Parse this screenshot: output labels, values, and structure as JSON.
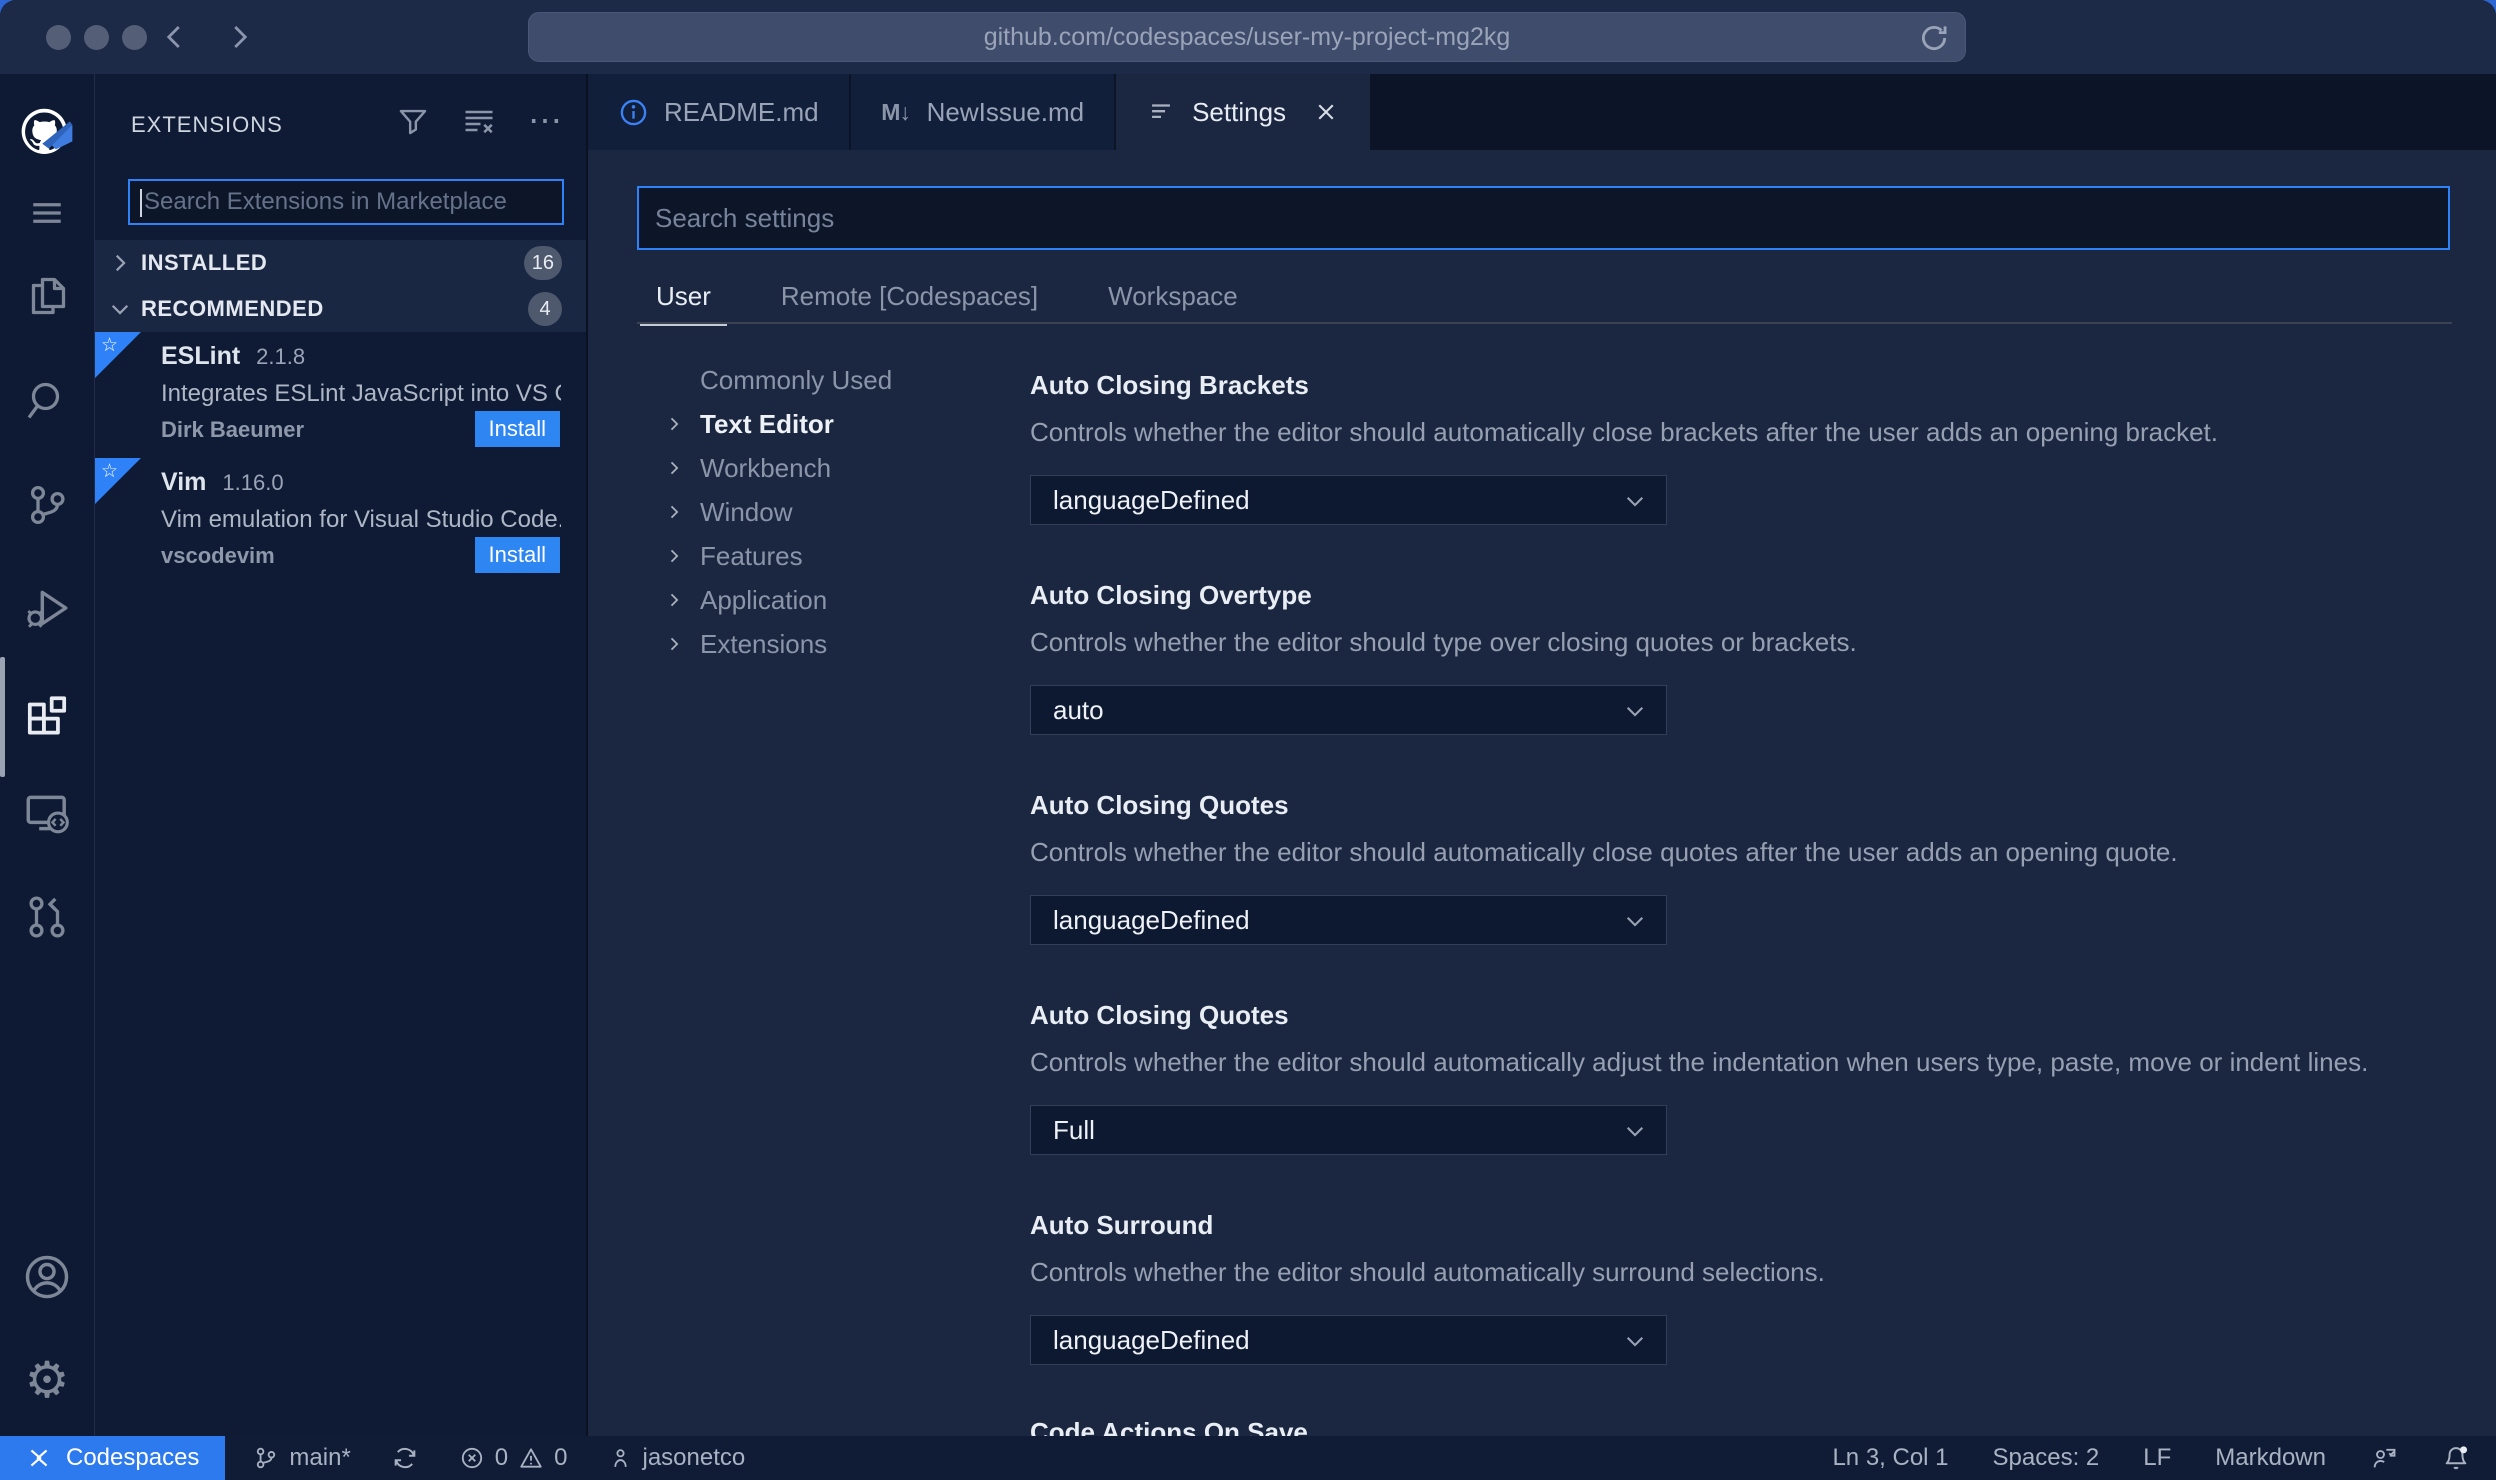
{
  "browser": {
    "url": "github.com/codespaces/user-my-project-mg2kg"
  },
  "sidebar": {
    "title": "EXTENSIONS",
    "search_placeholder": "Search Extensions in Marketplace",
    "sections": [
      {
        "label": "INSTALLED",
        "count": "16"
      },
      {
        "label": "RECOMMENDED",
        "count": "4"
      }
    ],
    "extensions": [
      {
        "name": "ESLint",
        "version": "2.1.8",
        "description": "Integrates ESLint JavaScript into VS C...",
        "author": "Dirk Baeumer",
        "action_label": "Install"
      },
      {
        "name": "Vim",
        "version": "1.16.0",
        "description": "Vim emulation for Visual Studio Code...",
        "author": "vscodevim",
        "action_label": "Install"
      }
    ]
  },
  "editor": {
    "tabs": [
      {
        "label": "README.md"
      },
      {
        "label": "NewIssue.md"
      },
      {
        "label": "Settings"
      }
    ]
  },
  "settings": {
    "search_placeholder": "Search settings",
    "scopes": [
      {
        "label": "User"
      },
      {
        "label": "Remote [Codespaces]"
      },
      {
        "label": "Workspace"
      }
    ],
    "toc": [
      {
        "label": "Commonly Used"
      },
      {
        "label": "Text Editor"
      },
      {
        "label": "Workbench"
      },
      {
        "label": "Window"
      },
      {
        "label": "Features"
      },
      {
        "label": "Application"
      },
      {
        "label": "Extensions"
      }
    ],
    "entries": [
      {
        "title": "Auto Closing Brackets",
        "description": "Controls whether the editor should automatically close brackets after the user adds an opening bracket.",
        "value": "languageDefined"
      },
      {
        "title": "Auto Closing Overtype",
        "description": "Controls whether the editor should type over closing quotes or brackets.",
        "value": "auto"
      },
      {
        "title": "Auto Closing Quotes",
        "description": "Controls whether the editor should automatically close quotes after the user adds an opening quote.",
        "value": "languageDefined"
      },
      {
        "title": "Auto Closing Quotes",
        "description": "Controls whether the editor should automatically adjust the indentation when users type, paste, move or indent lines.",
        "value": "Full"
      },
      {
        "title": "Auto Surround",
        "description": "Controls whether the editor should automatically surround selections.",
        "value": "languageDefined"
      },
      {
        "title": "Code Actions On Save",
        "description": "",
        "value": ""
      }
    ]
  },
  "status_bar": {
    "remote_label": "Codespaces",
    "branch": "main*",
    "errors": "0",
    "warnings": "0",
    "user": "jasonetco",
    "cursor": "Ln 3, Col 1",
    "indent": "Spaces: 2",
    "eol": "LF",
    "language": "Markdown"
  },
  "icons": {
    "more_actions": "⋯",
    "markdown_tab": "M↓",
    "gear": "⚙",
    "star": "☆"
  },
  "colors": {
    "accent_blue": "#2f81f7",
    "install_blue": "#2e86f2",
    "codespaces_blue": "#2d79ee",
    "badge_gray": "#4f596d"
  }
}
